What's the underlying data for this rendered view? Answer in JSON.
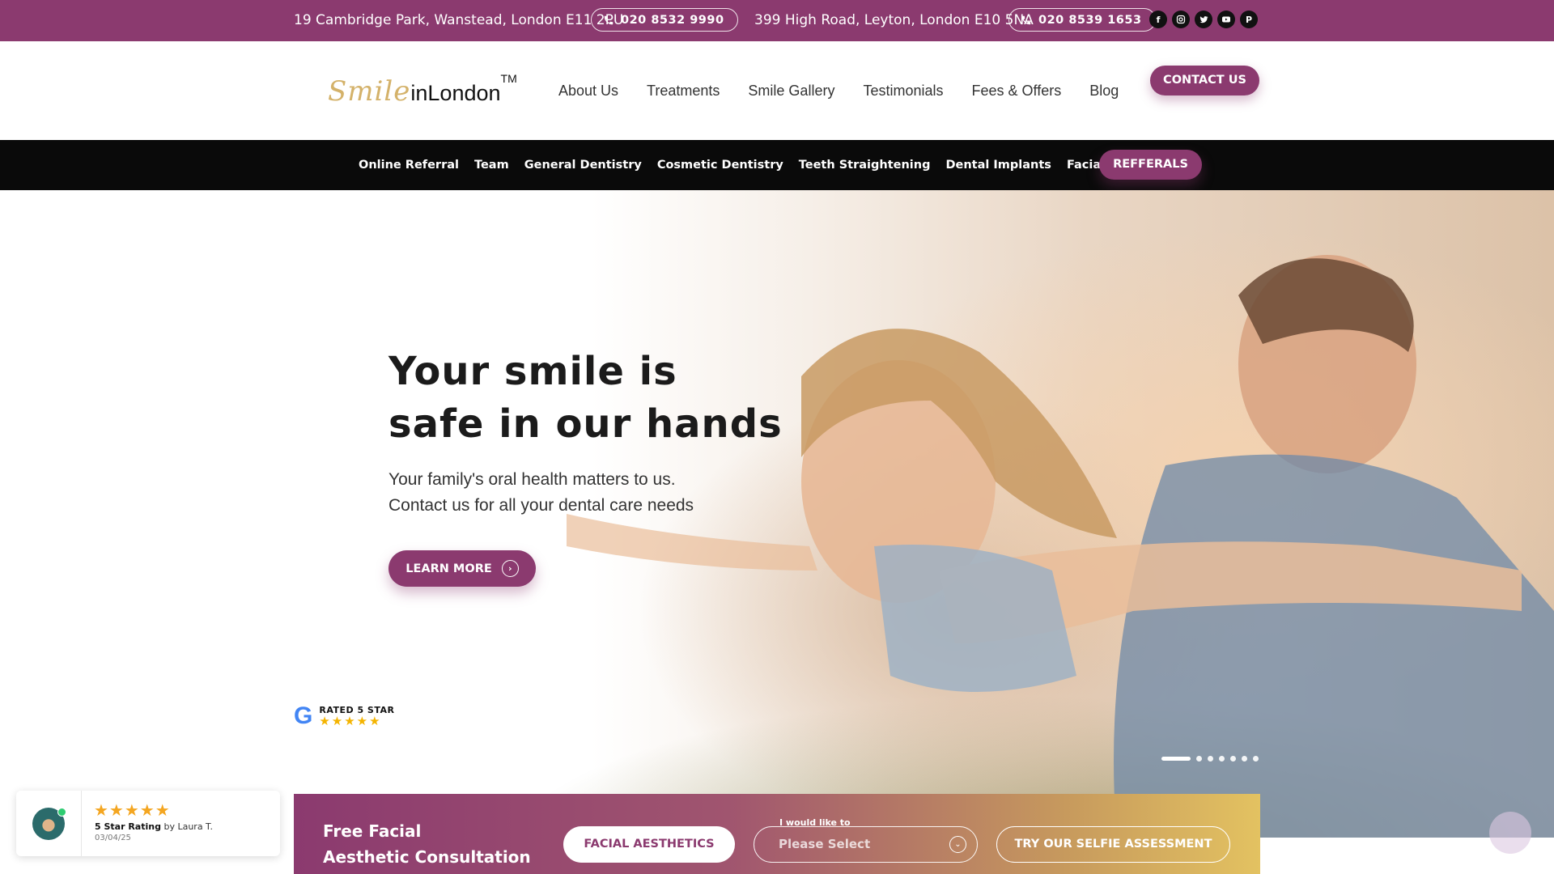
{
  "topbar": {
    "address1": "19 Cambridge Park, Wanstead, London E11 2PU",
    "phone1": "020 8532 9990",
    "address2": "399 High Road, Leyton, London E10 5NA",
    "phone2": "020 8539 1653",
    "socials": [
      "facebook-icon",
      "instagram-icon",
      "twitter-icon",
      "youtube-icon",
      "pinterest-icon"
    ]
  },
  "logo": {
    "smile": "Smile",
    "in_london": "inLondon",
    "tm": "TM"
  },
  "main_nav": [
    "About Us",
    "Treatments",
    "Smile Gallery",
    "Testimonials",
    "Fees & Offers",
    "Blog"
  ],
  "contact_button": "CONTACT US",
  "sub_nav": [
    "Online Referral",
    "Team",
    "General Dentistry",
    "Cosmetic Dentistry",
    "Teeth Straightening",
    "Dental Implants",
    "Facial Aesthetics"
  ],
  "referrals_button": "REFFERALS",
  "hero": {
    "title": "Your smile is\nsafe in our hands",
    "subtitle": "Your family's oral health matters to us.\nContact us for all your dental care needs",
    "button": "LEARN MORE"
  },
  "google_badge": {
    "letter": "G",
    "text": "RATED 5 STAR",
    "stars": "★★★★★"
  },
  "slider": {
    "slide_count": 7,
    "active_index": 0
  },
  "consultation": {
    "title": "Free Facial\nAesthetic Consultation",
    "facial_button": "FACIAL AESTHETICS",
    "select_label": "I would like to",
    "select_placeholder": "Please Select",
    "selfie_button": "TRY OUR SELFIE ASSESSMENT"
  },
  "review_widget": {
    "stars": "★★★★★",
    "rating_text": "5 Star Rating",
    "by": "by Laura T.",
    "date": "03/04/25"
  },
  "colors": {
    "brand": "#8b3a6f",
    "gold": "#d4b26a",
    "black_bar": "#0a0a0a"
  }
}
